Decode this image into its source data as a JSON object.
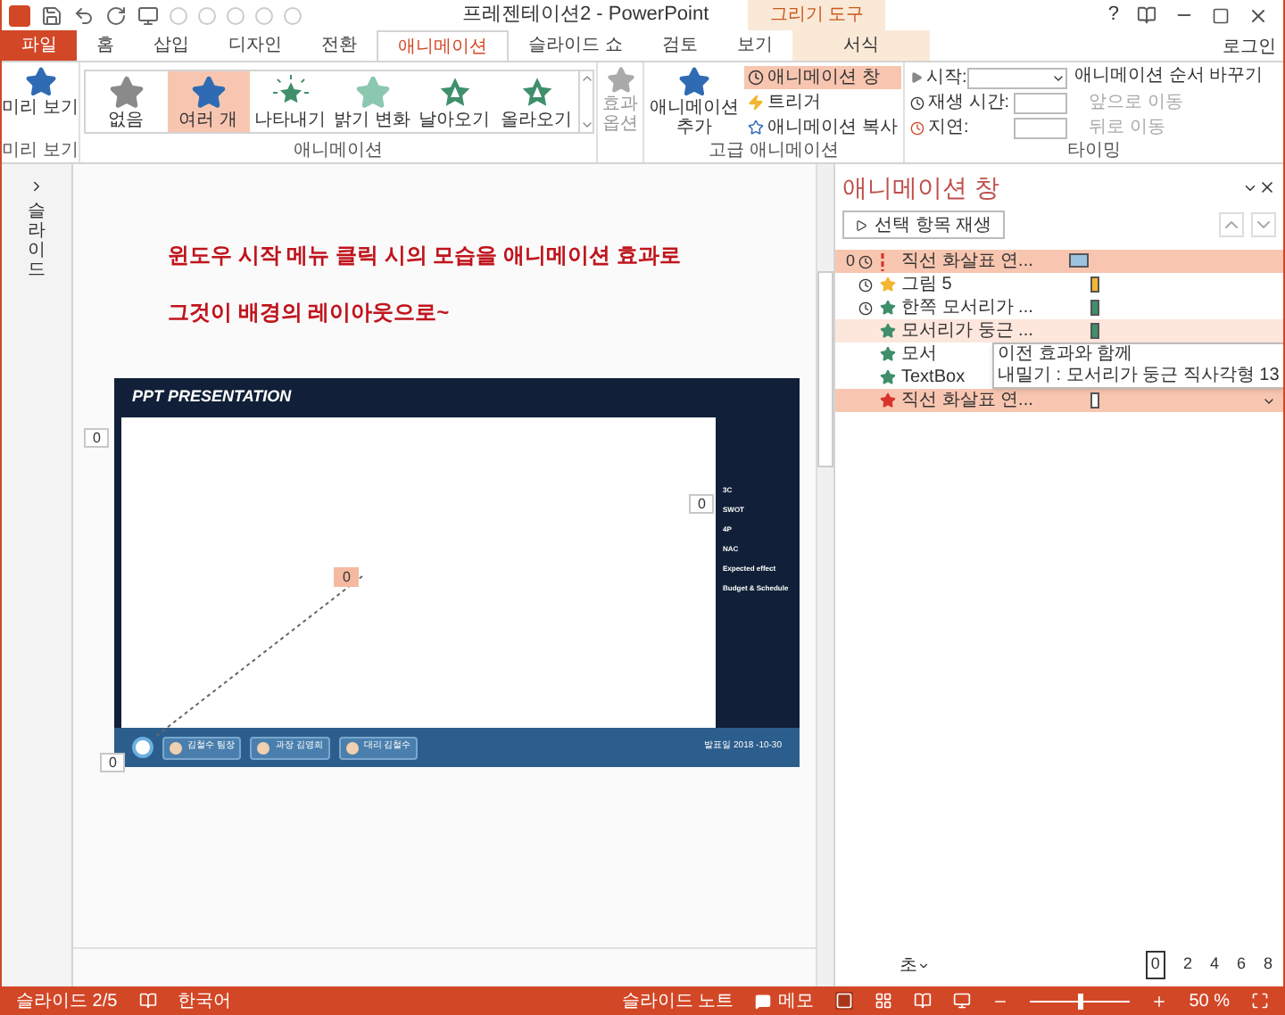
{
  "title_bar": {
    "title": "프레젠테이션2 - PowerPoint",
    "context_label": "그리기 도구",
    "help": "?",
    "sign_in": "로그인"
  },
  "tabs": [
    {
      "label": "파일",
      "kind": "file",
      "selected": false
    },
    {
      "label": "홈",
      "kind": "normal",
      "selected": false
    },
    {
      "label": "삽입",
      "kind": "normal",
      "selected": false
    },
    {
      "label": "디자인",
      "kind": "normal",
      "selected": false
    },
    {
      "label": "전환",
      "kind": "normal",
      "selected": false
    },
    {
      "label": "애니메이션",
      "kind": "normal",
      "selected": true
    },
    {
      "label": "슬라이드 쇼",
      "kind": "normal",
      "selected": false
    },
    {
      "label": "검토",
      "kind": "normal",
      "selected": false
    },
    {
      "label": "보기",
      "kind": "normal",
      "selected": false
    },
    {
      "label": "서식",
      "kind": "context",
      "selected": false
    }
  ],
  "ribbon": {
    "preview": {
      "label": "미리 보기",
      "group": "미리 보기"
    },
    "gallery": {
      "group": "애니메이션",
      "effect_options": "효과 옵션",
      "items": [
        {
          "label": "없음",
          "kind": "none",
          "selected": false
        },
        {
          "label": "여러 개",
          "kind": "multiple",
          "selected": true
        },
        {
          "label": "나타내기",
          "kind": "appear",
          "selected": false
        },
        {
          "label": "밝기 변화",
          "kind": "fade",
          "selected": false
        },
        {
          "label": "날아오기",
          "kind": "fly",
          "selected": false
        },
        {
          "label": "올라오기",
          "kind": "float",
          "selected": false
        }
      ]
    },
    "advanced": {
      "group": "고급 애니메이션",
      "add": "애니메이션 추가",
      "pane": {
        "label": "애니메이션 창",
        "selected": true
      },
      "trigger": "트리거",
      "copy": "애니메이션 복사"
    },
    "timing": {
      "group": "타이밍",
      "start": "시작:",
      "duration": "재생 시간:",
      "delay": "지연:",
      "reorder": "애니메이션 순서 바꾸기",
      "earlier": {
        "label": "앞으로 이동",
        "disabled": true
      },
      "later": {
        "label": "뒤로 이동",
        "disabled": true
      }
    }
  },
  "thumbnails": {
    "label": "슬라이드"
  },
  "notes_text": [
    "윈도우 시작 메뉴 클릭 시의 모습을 애니메이션 효과로",
    "그것이 배경의 레이아웃으로~"
  ],
  "slide": {
    "title": "PPT PRESENTATION",
    "menu": [
      "3C",
      "SWOT",
      "4P",
      "NAC",
      "Expected effect",
      "Budget & Schedule"
    ],
    "people": [
      "김철수 팀장",
      "과장 김영희",
      "대리 김철수"
    ],
    "date": "발표일 2018 -10-30",
    "tags": [
      "0",
      "0",
      "0",
      "0"
    ]
  },
  "animation_pane": {
    "title": "애니메이션 창",
    "play": "선택 항목 재생",
    "items": [
      {
        "number": "0",
        "timed": true,
        "kind": "path",
        "color": "#d9342b",
        "name": "직선 화살표 연...",
        "selected": true,
        "hover": false
      },
      {
        "timed": true,
        "kind": "star",
        "color": "#f2b632",
        "name": "그림 5",
        "selected": false,
        "hover": false
      },
      {
        "timed": true,
        "kind": "star",
        "color": "#3f8f6b",
        "name": "한쪽 모서리가 ...",
        "selected": false,
        "hover": false
      },
      {
        "timed": false,
        "kind": "star",
        "color": "#3f8f6b",
        "name": "모서리가 둥근 ...",
        "selected": false,
        "hover": true
      },
      {
        "timed": false,
        "kind": "star",
        "color": "#3f8f6b",
        "name": "모서",
        "selected": false,
        "hover": false
      },
      {
        "timed": false,
        "kind": "star",
        "color": "#3f8f6b",
        "name": "TextBox",
        "selected": false,
        "hover": false
      },
      {
        "timed": false,
        "kind": "star",
        "color": "#d9342b",
        "name": "직선 화살표 연...",
        "selected": true,
        "hover": false
      }
    ],
    "tooltip": [
      "이전 효과와 함께",
      "내밀기 : 모서리가 둥근 직사각형 13"
    ],
    "unit": "초",
    "ticks": [
      "0",
      "2",
      "4",
      "6",
      "8"
    ]
  },
  "status_bar": {
    "slide": "슬라이드 2/5",
    "language": "한국어",
    "notes": "슬라이드 노트",
    "comments": "메모",
    "zoom": {
      "level": 0.5,
      "reading": "50 %"
    }
  }
}
